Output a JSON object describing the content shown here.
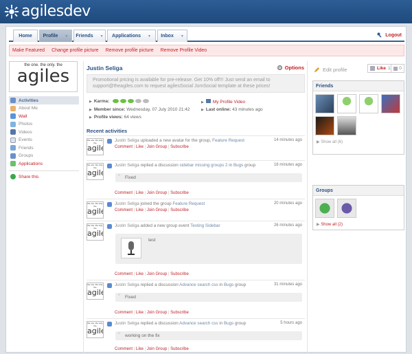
{
  "app": {
    "logo_text": "agilesdev"
  },
  "nav": {
    "tabs": [
      {
        "label": "Home"
      },
      {
        "label": "Profile"
      },
      {
        "label": "Friends"
      },
      {
        "label": "Applications"
      },
      {
        "label": "Inbox"
      }
    ],
    "logout": "Logout"
  },
  "actions": [
    "Make Featured",
    "Change profile picture",
    "Remove profile picture",
    "Remove Profile Video"
  ],
  "brand": {
    "tagline": "the one. the only. the",
    "name": "agiles"
  },
  "sidebar": {
    "items": [
      {
        "label": "Activities",
        "icon": "activities-icon"
      },
      {
        "label": "About Me",
        "icon": "person-icon"
      },
      {
        "label": "Wall",
        "icon": "wall-icon"
      },
      {
        "label": "Photos",
        "icon": "photos-icon"
      },
      {
        "label": "Videos",
        "icon": "videos-icon"
      },
      {
        "label": "Events",
        "icon": "events-icon"
      },
      {
        "label": "Friends",
        "icon": "friends-icon"
      },
      {
        "label": "Groups",
        "icon": "groups-icon"
      },
      {
        "label": "Applications",
        "icon": "applications-icon"
      }
    ],
    "share": "Share this"
  },
  "profile": {
    "name": "Justin Seliga",
    "options": "Options",
    "promo": "Promotional pricing is available for pre-release.  Get 10% off!!! Just send an email to support@theagiles.com to request agilesSocial JomSocial template at these prices!",
    "karma_label": "Karma:",
    "member_since_label": "Member since:",
    "member_since": "Wednesday, 07 July 2010 21:42",
    "profile_views_label": "Profile views:",
    "profile_views": "64 views",
    "video_link": "My Profile Video",
    "last_online_label": "Last online:",
    "last_online": "43 minutes ago"
  },
  "recent": {
    "title": "Recent activities",
    "link_labels": [
      "Comment",
      "Like",
      "Join Group",
      "Subscribe"
    ],
    "items": [
      {
        "actor": "Justin Seliga",
        "text": "uploaded a new avatar for the group,",
        "target": "Feature Request",
        "time": "14 minutes ago"
      },
      {
        "actor": "Justin Seliga",
        "text": "replied a discussion",
        "target": "sidebar missing groups 2",
        "mid": "in",
        "group": "Bugs",
        "tail": "group",
        "time": "16 minutes ago",
        "quote": "Fixed"
      },
      {
        "actor": "Justin Seliga",
        "text": "joined the group",
        "target": "Feature Request",
        "time": "20 minutes ago"
      },
      {
        "actor": "Justin Seliga",
        "text": "added a new group event",
        "target": "Testing Sidebar",
        "time": "26 minutes ago",
        "quote": "test"
      },
      {
        "actor": "Justin Seliga",
        "text": "replied a discussion",
        "target": "Advance search css",
        "mid": "in",
        "group": "Bugs",
        "tail": "group",
        "time": "31 minutes ago",
        "quote": "Fixed"
      },
      {
        "actor": "Justin Seliga",
        "text": "replied a discussion",
        "target": "Advance search css",
        "mid": "in",
        "group": "Bugs",
        "tail": "group",
        "time": "5 hours ago",
        "quote": "working on the fix"
      }
    ]
  },
  "right": {
    "edit_profile": "Edit profile",
    "like": "Like",
    "like_count": "1",
    "dislike_count": "0",
    "friends_title": "Friends",
    "friends_showall": "Show all (6)",
    "groups_title": "Groups",
    "groups_showall": "Show all (2)"
  },
  "colors": {
    "accent_red": "#c01f25",
    "nav_blue": "#2a4f80",
    "top_bar": "#2c5d95"
  }
}
